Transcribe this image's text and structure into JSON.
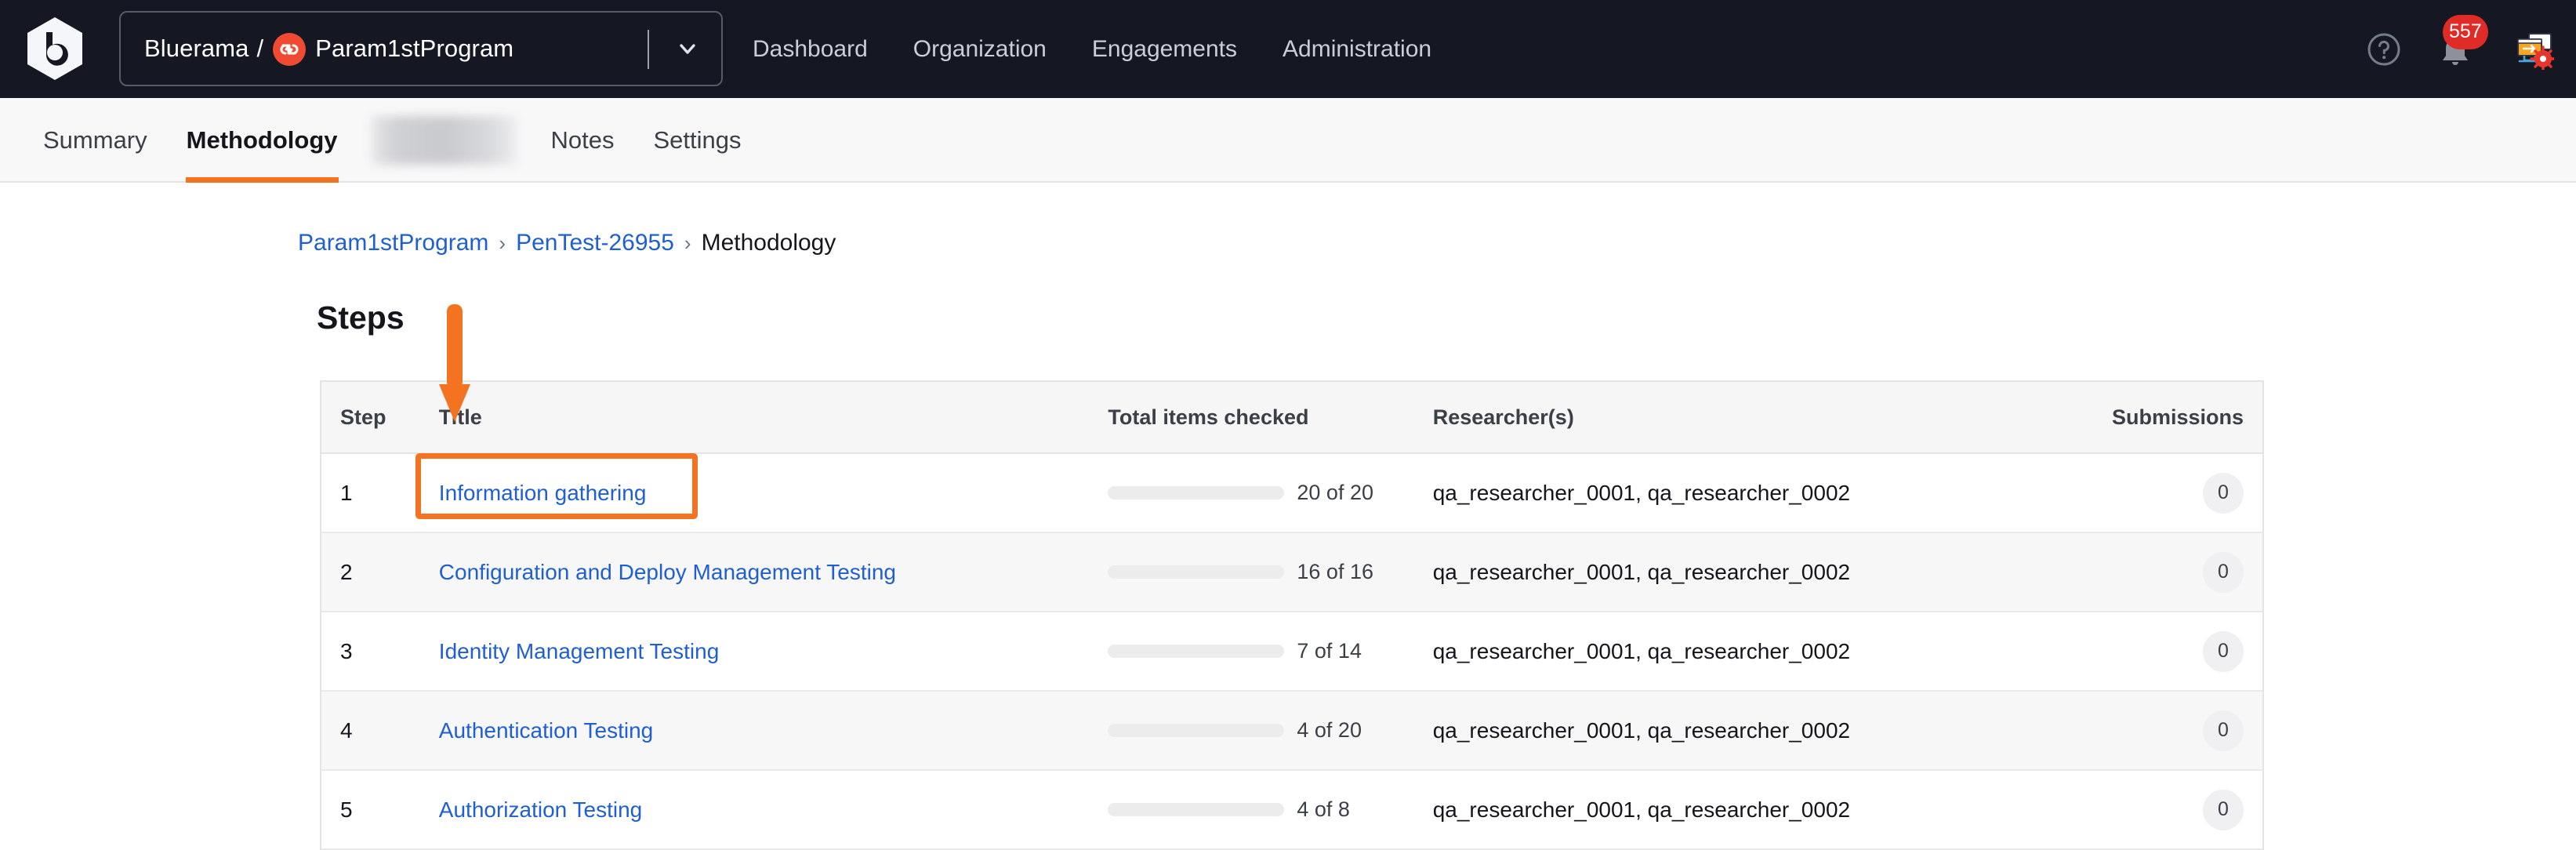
{
  "topnav": {
    "logo_icon": "bugcrowd-hexagon-logo",
    "org_switcher": {
      "org_name": "Bluerama",
      "separator": "/",
      "program_name": "Param1stProgram",
      "avatar_icon": "program-avatar-icon",
      "chevron_icon": "chevron-down-icon"
    },
    "links": [
      {
        "label": "Dashboard"
      },
      {
        "label": "Organization"
      },
      {
        "label": "Engagements"
      },
      {
        "label": "Administration"
      }
    ],
    "help_icon": "help-circle-icon",
    "notifications": {
      "icon": "bell-icon",
      "count": "557"
    },
    "app_icon": "app-settings-icon",
    "background_color": "#151823"
  },
  "tabbar": {
    "tabs": [
      {
        "label": "Summary",
        "active": false,
        "redacted": false
      },
      {
        "label": "Methodology",
        "active": true,
        "redacted": false
      },
      {
        "label": "",
        "active": false,
        "redacted": true
      },
      {
        "label": "Notes",
        "active": false,
        "redacted": false
      },
      {
        "label": "Settings",
        "active": false,
        "redacted": false
      }
    ],
    "active_underline_color": "#f47321"
  },
  "breadcrumb": {
    "items": [
      {
        "label": "Param1stProgram",
        "link": true
      },
      {
        "label": "PenTest-26955",
        "link": true
      },
      {
        "label": "Methodology",
        "link": false
      }
    ],
    "separator": "›"
  },
  "main": {
    "heading": "Steps",
    "table": {
      "columns": {
        "step": "Step",
        "title": "Title",
        "total": "Total items checked",
        "researchers": "Researcher(s)",
        "submissions": "Submissions"
      },
      "rows": [
        {
          "step": "1",
          "title": "Information gathering",
          "progress_text": "20 of 20",
          "progress_pct": 100,
          "progress_color": "#3d7a0c",
          "researchers": "qa_researcher_0001, qa_researcher_0002",
          "submissions": "0"
        },
        {
          "step": "2",
          "title": "Configuration and Deploy Management Testing",
          "progress_text": "16 of 16",
          "progress_pct": 100,
          "progress_color": "#3d7a0c",
          "researchers": "qa_researcher_0001, qa_researcher_0002",
          "submissions": "0"
        },
        {
          "step": "3",
          "title": "Identity Management Testing",
          "progress_text": "7 of 14",
          "progress_pct": 50,
          "progress_color": "#f96a08",
          "researchers": "qa_researcher_0001, qa_researcher_0002",
          "submissions": "0"
        },
        {
          "step": "4",
          "title": "Authentication Testing",
          "progress_text": "4 of 20",
          "progress_pct": 20,
          "progress_color": "#2a72d4",
          "researchers": "qa_researcher_0001, qa_researcher_0002",
          "submissions": "0"
        },
        {
          "step": "5",
          "title": "Authorization Testing",
          "progress_text": "4 of 8",
          "progress_pct": 50,
          "progress_color": "#f96a08",
          "researchers": "qa_researcher_0001, qa_researcher_0002",
          "submissions": "0"
        }
      ]
    }
  },
  "annotations": {
    "arrow_icon": "down-arrow-annotation",
    "highlight_box": "cell-highlight-annotation",
    "color": "#f47321"
  }
}
